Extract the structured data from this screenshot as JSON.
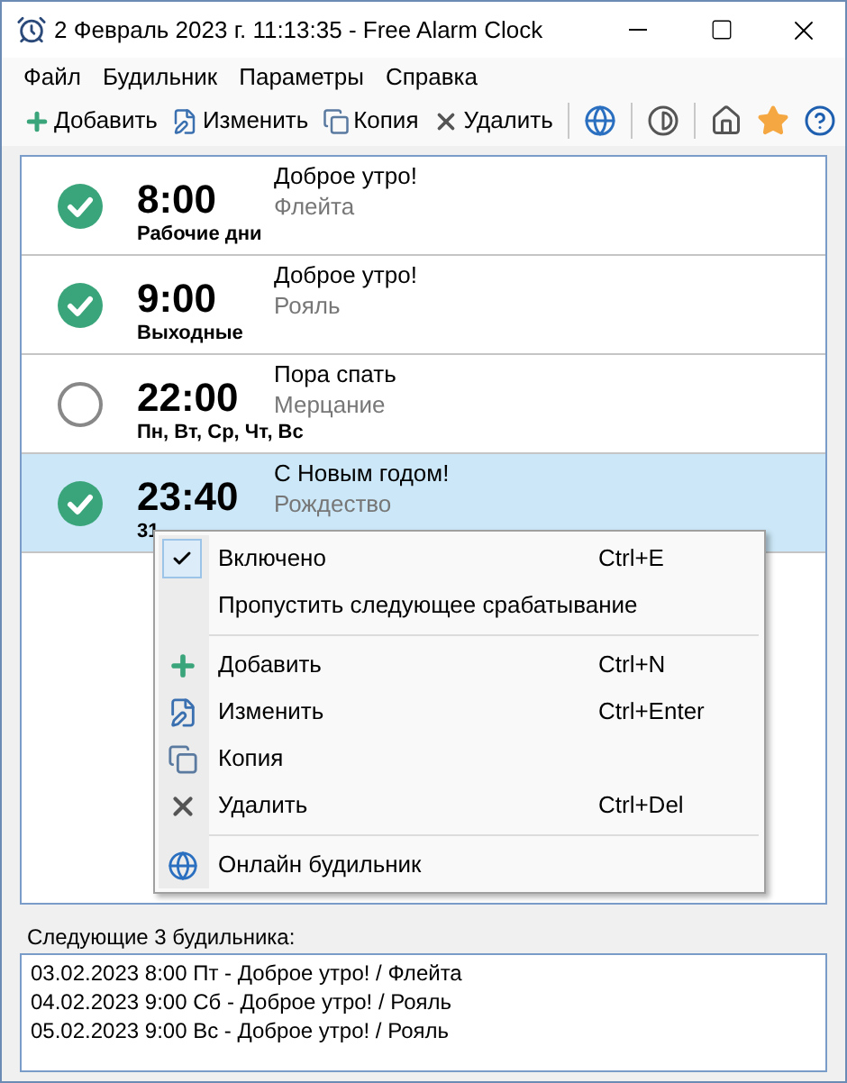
{
  "window": {
    "title": "2 Февраль 2023 г. 11:13:35 - Free Alarm Clock"
  },
  "menu": [
    "Файл",
    "Будильник",
    "Параметры",
    "Справка"
  ],
  "toolbar": [
    {
      "kind": "add",
      "label": "Добавить"
    },
    {
      "kind": "edit",
      "label": "Изменить"
    },
    {
      "kind": "copy",
      "label": "Копия"
    },
    {
      "kind": "delete",
      "label": "Удалить"
    },
    {
      "kind": "separator"
    },
    {
      "kind": "online"
    },
    {
      "kind": "separator"
    },
    {
      "kind": "theme"
    },
    {
      "kind": "separator"
    },
    {
      "kind": "home"
    },
    {
      "kind": "star"
    },
    {
      "kind": "help"
    }
  ],
  "alarms": [
    {
      "time": "8:00",
      "days": "Рабочие дни",
      "label": "Доброе утро!",
      "sound": "Флейта",
      "enabled": true,
      "selected": false
    },
    {
      "time": "9:00",
      "days": "Выходные",
      "label": "Доброе утро!",
      "sound": "Рояль",
      "enabled": true,
      "selected": false
    },
    {
      "time": "22:00",
      "days": "Пн, Вт, Ср, Чт, Вс",
      "label": "Пора спать",
      "sound": "Мерцание",
      "enabled": false,
      "selected": false
    },
    {
      "time": "23:40",
      "days": "31",
      "label": "С Новым годом!",
      "sound": "Рождество",
      "enabled": true,
      "selected": true
    }
  ],
  "context_menu": [
    {
      "kind": "check",
      "label": "Включено",
      "shortcut": "Ctrl+E",
      "checked": true
    },
    {
      "kind": "plain",
      "label": "Пропустить следующее срабатывание"
    },
    {
      "kind": "separator"
    },
    {
      "kind": "add",
      "label": "Добавить",
      "shortcut": "Ctrl+N"
    },
    {
      "kind": "edit",
      "label": "Изменить",
      "shortcut": "Ctrl+Enter"
    },
    {
      "kind": "copy",
      "label": "Копия"
    },
    {
      "kind": "delete",
      "label": "Удалить",
      "shortcut": "Ctrl+Del"
    },
    {
      "kind": "separator"
    },
    {
      "kind": "online",
      "label": "Онлайн будильник"
    }
  ],
  "next_alarms": {
    "title": "Следующие 3 будильника:",
    "items": [
      "03.02.2023 8:00 Пт - Доброе утро! / Флейта",
      "04.02.2023 9:00 Сб - Доброе утро! / Рояль",
      "05.02.2023 9:00 Вс - Доброе утро! / Рояль"
    ]
  }
}
